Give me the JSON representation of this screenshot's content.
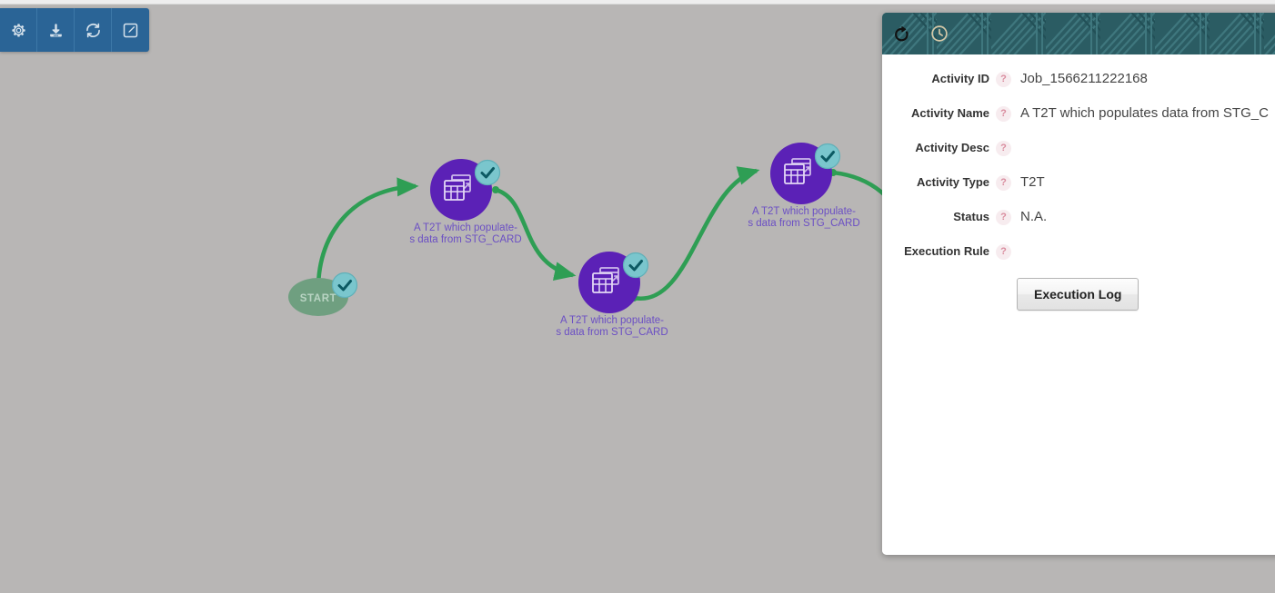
{
  "toolbar": {
    "buttons": [
      {
        "name": "settings-button",
        "icon": "gear-icon",
        "label": "Settings"
      },
      {
        "name": "save-button",
        "icon": "download-icon",
        "label": "Save"
      },
      {
        "name": "refresh-button",
        "icon": "refresh-icon",
        "label": "Refresh"
      },
      {
        "name": "edit-button",
        "icon": "edit-square-icon",
        "label": "Edit"
      }
    ]
  },
  "panel": {
    "header": {
      "buttons": [
        {
          "name": "undo-button",
          "icon": "undo-history-icon",
          "label": "Undo"
        },
        {
          "name": "schedule-button",
          "icon": "clock-icon",
          "label": "Schedule"
        }
      ]
    },
    "fields": [
      {
        "label": "Activity ID",
        "help": "?",
        "value": "Job_1566211222168"
      },
      {
        "label": "Activity Name",
        "help": "?",
        "value": "A T2T which populates data from STG_C"
      },
      {
        "label": "Activity Desc",
        "help": "?",
        "value": ""
      },
      {
        "label": "Activity Type",
        "help": "?",
        "value": "T2T"
      },
      {
        "label": "Status",
        "help": "?",
        "value": "N.A."
      },
      {
        "label": "Execution Rule",
        "help": "?",
        "value": ""
      }
    ],
    "execution_log_label": "Execution Log"
  },
  "flow": {
    "start_node": {
      "label": "START",
      "status": "complete"
    },
    "nodes": [
      {
        "label_line1": "A T2T which populate-",
        "label_line2": "s data from STG_CARD",
        "type": "T2T",
        "status": "complete"
      },
      {
        "label_line1": "A T2T which populate-",
        "label_line2": "s data from STG_CARD",
        "type": "T2T",
        "status": "complete"
      },
      {
        "label_line1": "A T2T which populate-",
        "label_line2": "s data from STG_CARD",
        "type": "T2T",
        "status": "complete"
      }
    ]
  },
  "colors": {
    "toolbar_bg": "#2a6496",
    "panel_header_bg": "#2b5c63",
    "node_purple": "#5b21b6",
    "start_green": "#6f9f80",
    "connector_green": "#2e9e54",
    "badge_teal": "#7ac6cd",
    "canvas_bg": "#b3b2b0",
    "label_purple": "#6b4fc4"
  }
}
